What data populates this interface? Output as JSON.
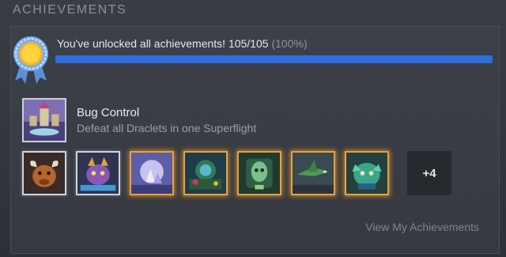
{
  "section": {
    "title": "ACHIEVEMENTS"
  },
  "summary": {
    "message": "You've unlocked all achievements!",
    "count": "105/105",
    "percent": "(100%)",
    "progress_fraction": 1.0,
    "bar_color": "#2f6fe0"
  },
  "latest": {
    "name": "Bug Control",
    "description": "Defeat all Draclets in one Superflight",
    "icon": "castle-scene-icon"
  },
  "badges": [
    {
      "icon": "bull-character-icon",
      "frame": "silver"
    },
    {
      "icon": "purple-dragon-icon",
      "frame": "silver"
    },
    {
      "icon": "crystal-cave-icon",
      "frame": "gold"
    },
    {
      "icon": "forest-portal-icon",
      "frame": "gold"
    },
    {
      "icon": "green-mask-icon",
      "frame": "gold"
    },
    {
      "icon": "green-bird-icon",
      "frame": "gold"
    },
    {
      "icon": "green-creature-icon",
      "frame": "gold"
    }
  ],
  "more": {
    "label": "+4"
  },
  "footer": {
    "link": "View My Achievements"
  },
  "colors": {
    "gold_frame": "#e9a23b",
    "silver_frame": "#cfd5de"
  }
}
